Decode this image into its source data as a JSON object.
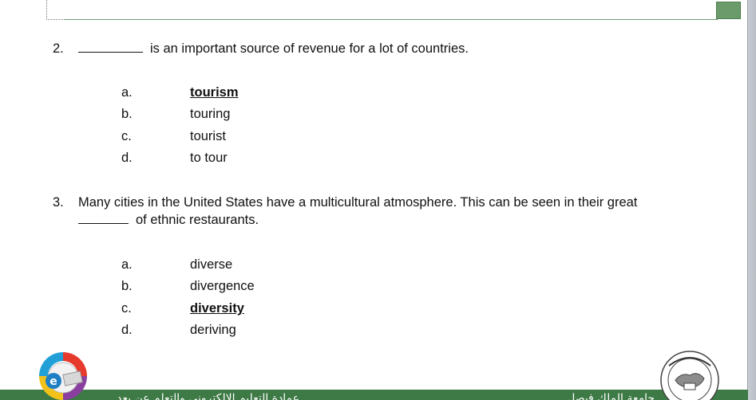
{
  "questions": [
    {
      "number": "2.",
      "text": "is an important source of revenue for a lot of countries.",
      "options": [
        {
          "letter": "a.",
          "text": "tourism",
          "answer": true
        },
        {
          "letter": "b.",
          "text": "touring",
          "answer": false
        },
        {
          "letter": "c.",
          "text": "tourist",
          "answer": false
        },
        {
          "letter": "d.",
          "text": "to tour",
          "answer": false
        }
      ]
    },
    {
      "number": "3.",
      "text_line1": "Many cities in the United States have a multicultural atmosphere.  This can be seen in their great",
      "text_line2": "of ethnic restaurants.",
      "options": [
        {
          "letter": "a.",
          "text": "diverse",
          "answer": false
        },
        {
          "letter": "b.",
          "text": "divergence",
          "answer": false
        },
        {
          "letter": "c.",
          "text": "diversity",
          "answer": true
        },
        {
          "letter": "d.",
          "text": "deriving",
          "answer": false
        }
      ]
    }
  ],
  "footer": {
    "left_text": "عمادة التعليم الإلكتروني والتعلم عن بعد",
    "right_text": "جامعة الملك فيصل",
    "bar_color": "#3d7a45"
  },
  "icons": {
    "left_logo": "e-learning-logo-icon",
    "right_logo": "university-seal-icon"
  }
}
